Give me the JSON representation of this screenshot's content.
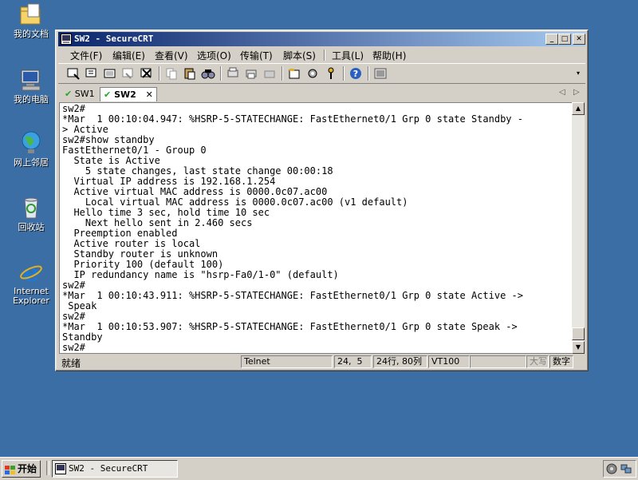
{
  "desktop": {
    "icons": [
      {
        "label": "我的文档"
      },
      {
        "label": "我的电脑"
      },
      {
        "label": "网上邻居"
      },
      {
        "label": "回收站"
      },
      {
        "label": "Internet Explorer"
      }
    ]
  },
  "window": {
    "title": "SW2 - SecureCRT",
    "menu": [
      "文件(F)",
      "编辑(E)",
      "查看(V)",
      "选项(O)",
      "传输(T)",
      "脚本(S)",
      "工具(L)",
      "帮助(H)"
    ],
    "tabs": [
      {
        "label": "SW1",
        "active": false
      },
      {
        "label": "SW2",
        "active": true
      }
    ],
    "terminal_lines": [
      "sw2#",
      "*Mar  1 00:10:04.947: %HSRP-5-STATECHANGE: FastEthernet0/1 Grp 0 state Standby -",
      "> Active",
      "sw2#show standby",
      "FastEthernet0/1 - Group 0",
      "  State is Active",
      "    5 state changes, last state change 00:00:18",
      "  Virtual IP address is 192.168.1.254",
      "  Active virtual MAC address is 0000.0c07.ac00",
      "    Local virtual MAC address is 0000.0c07.ac00 (v1 default)",
      "  Hello time 3 sec, hold time 10 sec",
      "    Next hello sent in 2.460 secs",
      "  Preemption enabled",
      "  Active router is local",
      "  Standby router is unknown",
      "  Priority 100 (default 100)",
      "  IP redundancy name is \"hsrp-Fa0/1-0\" (default)",
      "sw2#",
      "*Mar  1 00:10:43.911: %HSRP-5-STATECHANGE: FastEthernet0/1 Grp 0 state Active ->",
      " Speak",
      "sw2#",
      "*Mar  1 00:10:53.907: %HSRP-5-STATECHANGE: FastEthernet0/1 Grp 0 state Speak ->",
      "Standby",
      "sw2#"
    ],
    "status": {
      "ready": "就绪",
      "protocol": "Telnet",
      "cursor": "24,  5",
      "size": "24行, 80列",
      "emulation": "VT100",
      "caps": "大写",
      "num": "数字"
    }
  },
  "taskbar": {
    "start_label": "开始",
    "task_title": "SW2 - SecureCRT"
  }
}
